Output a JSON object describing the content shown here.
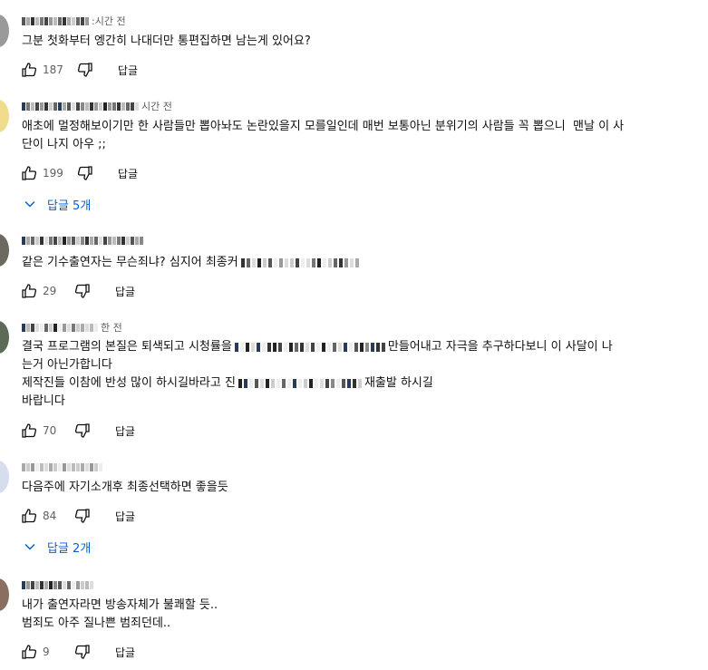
{
  "colors": {
    "text": "#0f0f0f",
    "meta": "#606060",
    "link": "#065fd4"
  },
  "comments": [
    {
      "time_suffix": ":시간 전",
      "lines": [
        "그분 첫화부터 엥간히 나대더만 통편집하면 남는게 있어요?"
      ],
      "likes": "187",
      "reply_label": "답글",
      "replies_label": ""
    },
    {
      "time_suffix": "시간 전",
      "lines": [
        "애초에 멀정해보이기만 한 사람들만 뽑아놔도 논란있을지 모를일인데 매번 보통아닌 분위기의 사람들 꼭 뽑으니  맨날 이 사",
        "단이 나지 아우 ;;"
      ],
      "likes": "199",
      "reply_label": "답글",
      "replies_label": "답글 5개"
    },
    {
      "time_suffix": "",
      "lines": [
        "같은 기수출연자는 무슨죄냐? 심지어 최종커"
      ],
      "likes": "29",
      "reply_label": "답글",
      "replies_label": ""
    },
    {
      "time_suffix": "한 전",
      "lines": [
        "결국 프로그램의 본질은 퇴색되고 시청률을",
        "만들어내고 자극을 추구하다보니 이 사달이 나",
        "는거 아닌가합니다",
        "제작진들 이참에 반성 많이 하시길바라고 진",
        "재출발 하시길",
        "바랍니다"
      ],
      "likes": "70",
      "reply_label": "답글",
      "replies_label": ""
    },
    {
      "time_suffix": "",
      "lines": [
        "다음주에 자기소개후 최종선택하면 좋을듯"
      ],
      "likes": "84",
      "reply_label": "답글",
      "replies_label": "답글 2개"
    },
    {
      "time_suffix": "",
      "lines": [
        "내가 출연자라면 방송자체가 불쾌할 듯..",
        "범죄도 아주 질나쁜 범죄던데.."
      ],
      "likes": "9",
      "reply_label": "답글",
      "replies_label": ""
    }
  ],
  "icons": {
    "like": "thumbs-up-icon",
    "dislike": "thumbs-down-icon",
    "expand": "chevron-down-icon"
  }
}
